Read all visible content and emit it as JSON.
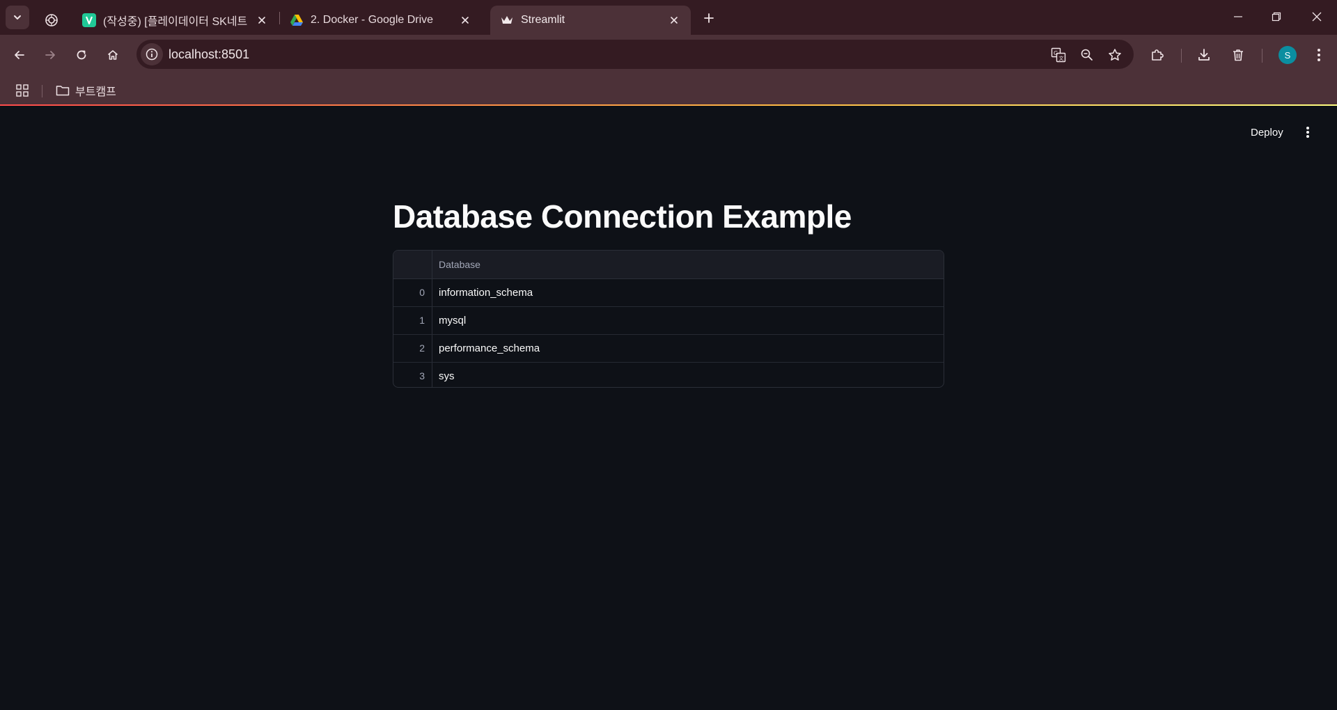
{
  "browser": {
    "tabs": [
      {
        "title": "(작성중) [플레이데이터 SK네트",
        "icon": "v-logo-icon",
        "active": false
      },
      {
        "title": "2. Docker - Google Drive",
        "icon": "google-drive-icon",
        "active": false
      },
      {
        "title": "Streamlit",
        "icon": "streamlit-crown-icon",
        "active": true
      }
    ],
    "url": "localhost:8501",
    "bookmark_folder": "부트캠프",
    "profile_initial": "S",
    "accent_color": "#0b8ea0"
  },
  "app": {
    "deploy_label": "Deploy",
    "title": "Database Connection Example",
    "table": {
      "columns": [
        "Database"
      ],
      "rows": [
        {
          "index": "0",
          "value": "information_schema"
        },
        {
          "index": "1",
          "value": "mysql"
        },
        {
          "index": "2",
          "value": "performance_schema"
        },
        {
          "index": "3",
          "value": "sys"
        }
      ]
    }
  }
}
